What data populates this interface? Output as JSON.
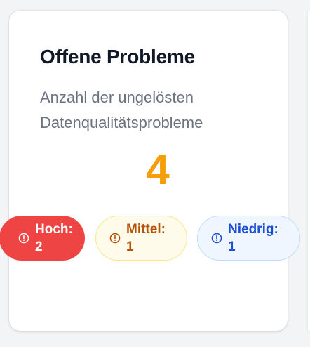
{
  "card": {
    "title": "Offene Probleme",
    "subtitle": "Anzahl der ungelösten Datenqualitätsprobleme",
    "count": "4",
    "badges": [
      {
        "label": "Hoch:",
        "value": "2",
        "icon": "alert-circle-icon",
        "color": "#ef4444"
      },
      {
        "label": "Mittel:",
        "value": "1",
        "icon": "alert-circle-icon",
        "color": "#b45309"
      },
      {
        "label": "Niedrig:",
        "value": "1",
        "icon": "alert-circle-icon",
        "color": "#1d4ed8"
      }
    ]
  },
  "colors": {
    "accent": "#f59e0b",
    "high": "#ef4444",
    "medium": "#b45309",
    "low": "#1d4ed8"
  }
}
